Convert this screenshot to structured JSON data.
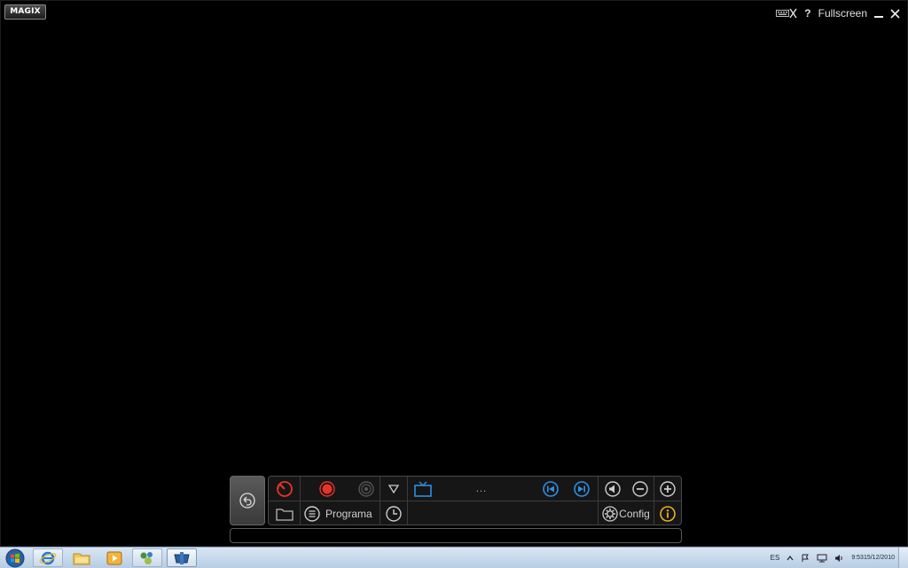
{
  "app": {
    "logo": "MAGIX",
    "fullscreen_label": "Fullscreen",
    "help_label": "?",
    "minimize_label": "_",
    "close_label": "✕"
  },
  "panel": {
    "program_label": "Programa",
    "channel_text": "...",
    "config_label": "Config",
    "status_text": ""
  },
  "taskbar": {
    "language": "ES",
    "time": "9:53",
    "date": "15/12/2010",
    "apps": [
      "internet-explorer",
      "file-explorer",
      "media-player",
      "network-app",
      "magix-app"
    ]
  },
  "colors": {
    "record_red": "#e8332a",
    "accent_blue": "#2e8fe0",
    "info_yellow": "#e8b21c",
    "taskbar_bg": "#c8d8ea"
  }
}
